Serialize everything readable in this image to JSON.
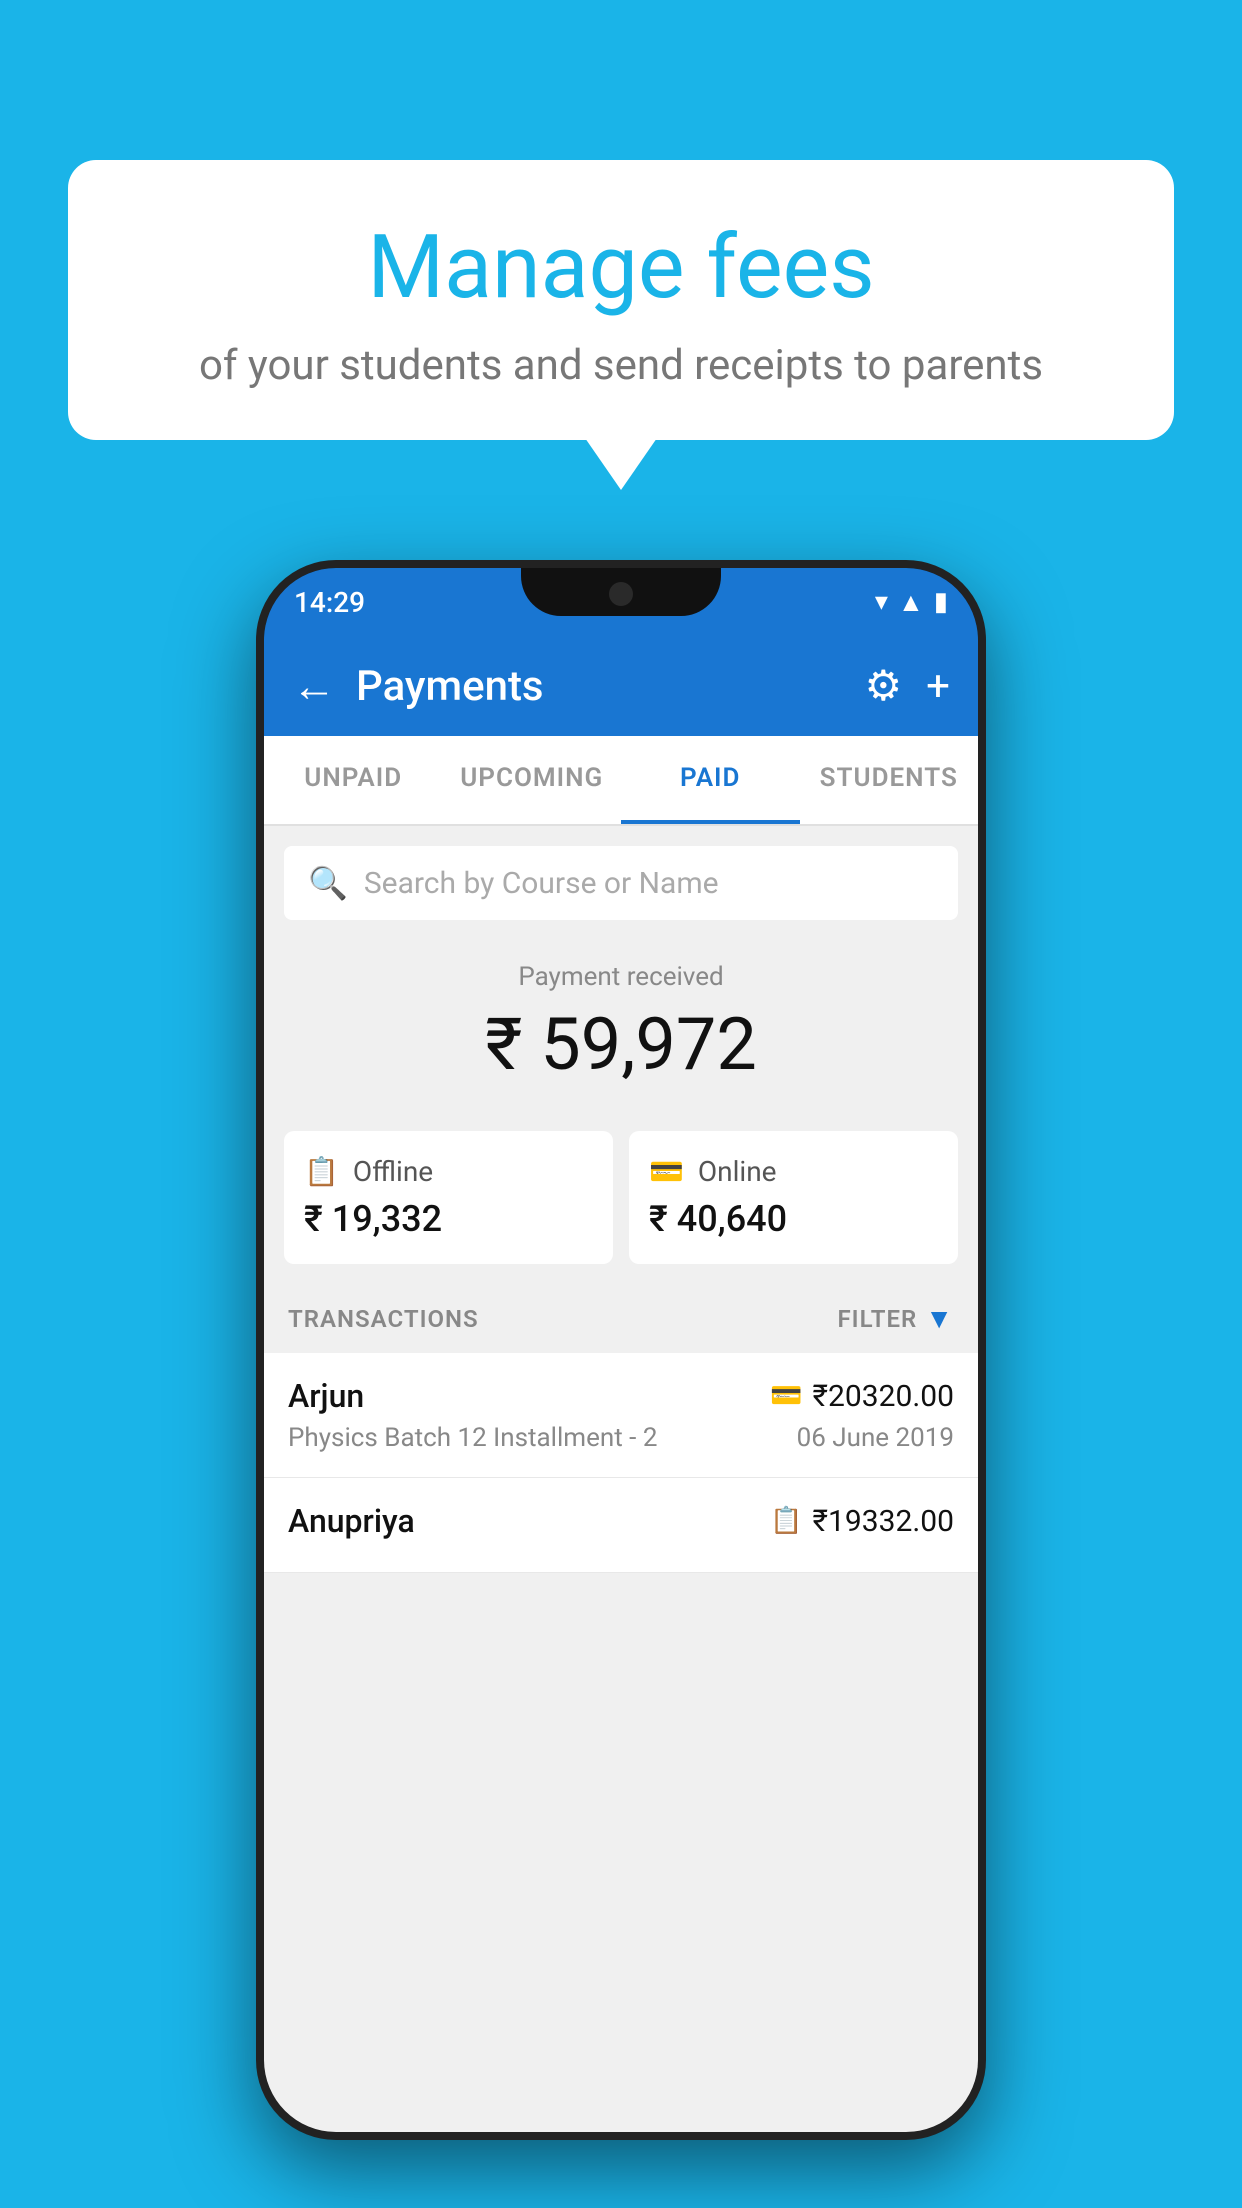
{
  "background_color": "#1ab4e8",
  "bubble": {
    "title": "Manage fees",
    "subtitle": "of your students and send receipts to parents"
  },
  "status_bar": {
    "time": "14:29",
    "icons": [
      "wifi",
      "signal",
      "battery"
    ]
  },
  "app_bar": {
    "title": "Payments",
    "back_label": "←",
    "gear_label": "⚙",
    "plus_label": "+"
  },
  "tabs": [
    {
      "label": "UNPAID",
      "active": false
    },
    {
      "label": "UPCOMING",
      "active": false
    },
    {
      "label": "PAID",
      "active": true
    },
    {
      "label": "STUDENTS",
      "active": false
    }
  ],
  "search": {
    "placeholder": "Search by Course or Name"
  },
  "payment_summary": {
    "received_label": "Payment received",
    "total_amount": "₹ 59,972",
    "offline_label": "Offline",
    "offline_amount": "₹ 19,332",
    "online_label": "Online",
    "online_amount": "₹ 40,640"
  },
  "transactions": {
    "header_label": "TRANSACTIONS",
    "filter_label": "FILTER",
    "rows": [
      {
        "name": "Arjun",
        "amount": "₹20320.00",
        "course": "Physics Batch 12 Installment - 2",
        "date": "06 June 2019",
        "payment_type": "online"
      },
      {
        "name": "Anupriya",
        "amount": "₹19332.00",
        "course": "",
        "date": "",
        "payment_type": "offline"
      }
    ]
  }
}
